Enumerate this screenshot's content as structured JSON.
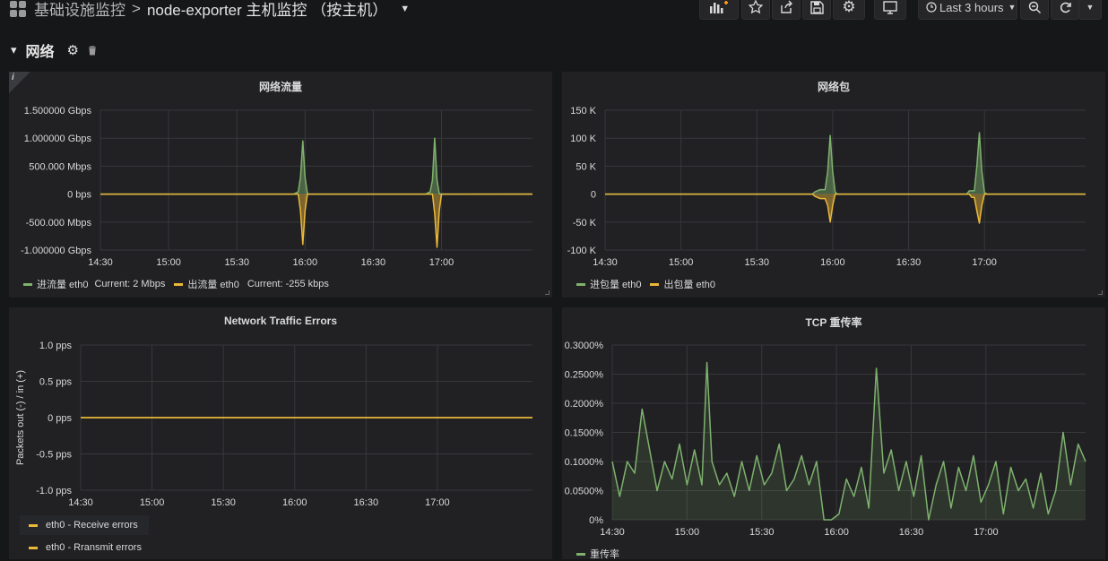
{
  "breadcrumb": {
    "parent": "基础设施监控",
    "separator": ">",
    "current": "node-exporter 主机监控 （按主机）"
  },
  "toolbar": {
    "time_range": "Last 3 hours"
  },
  "row": {
    "title": "网络"
  },
  "colors": {
    "green": "#7eb26d",
    "yellow": "#eab839"
  },
  "chart_data": [
    {
      "id": "panel1",
      "type": "line",
      "title": "网络流量",
      "x_ticks": [
        "14:30",
        "15:00",
        "15:30",
        "16:00",
        "16:30",
        "17:00"
      ],
      "x_range": [
        "14:30",
        "17:40"
      ],
      "ylim": [
        -1000000000,
        1500000000
      ],
      "y_ticks": [
        {
          "value": 1500000000,
          "label": "1.500000 Gbps"
        },
        {
          "value": 1000000000,
          "label": "1.000000 Gbps"
        },
        {
          "value": 500000000,
          "label": "500.000 Mbps"
        },
        {
          "value": 0,
          "label": "0 bps"
        },
        {
          "value": -500000000,
          "label": "-500.000 Mbps"
        },
        {
          "value": -1000000000,
          "label": "-1.000000 Gbps"
        }
      ],
      "series": [
        {
          "name": "进流量 eth0",
          "color": "#7eb26d",
          "current": "Current: 2 Mbps",
          "points": [
            [
              "14:30",
              0
            ],
            [
              "15:55",
              0
            ],
            [
              "15:57",
              40000000
            ],
            [
              "15:58",
              300000000
            ],
            [
              "15:59",
              950000000
            ],
            [
              "16:00",
              300000000
            ],
            [
              "16:01",
              10000000
            ],
            [
              "16:02",
              0
            ],
            [
              "16:53",
              0
            ],
            [
              "16:55",
              40000000
            ],
            [
              "16:56",
              250000000
            ],
            [
              "16:57",
              1000000000
            ],
            [
              "16:58",
              250000000
            ],
            [
              "16:59",
              10000000
            ],
            [
              "17:00",
              0
            ],
            [
              "17:40",
              2000000
            ]
          ]
        },
        {
          "name": "出流量 eth0",
          "color": "#eab839",
          "current": "Current: -255 kbps",
          "points": [
            [
              "14:30",
              0
            ],
            [
              "15:57",
              0
            ],
            [
              "15:58",
              -300000000
            ],
            [
              "15:59",
              -900000000
            ],
            [
              "16:00",
              -300000000
            ],
            [
              "16:01",
              0
            ],
            [
              "16:56",
              0
            ],
            [
              "16:57",
              -350000000
            ],
            [
              "16:58",
              -950000000
            ],
            [
              "16:59",
              -300000000
            ],
            [
              "17:00",
              0
            ],
            [
              "17:40",
              -255000
            ]
          ]
        }
      ]
    },
    {
      "id": "panel2",
      "type": "line",
      "title": "网络包",
      "x_ticks": [
        "14:30",
        "15:00",
        "15:30",
        "16:00",
        "16:30",
        "17:00"
      ],
      "x_range": [
        "14:30",
        "17:40"
      ],
      "ylim": [
        -100000,
        150000
      ],
      "y_ticks": [
        {
          "value": 150000,
          "label": "150 K"
        },
        {
          "value": 100000,
          "label": "100 K"
        },
        {
          "value": 50000,
          "label": "50 K"
        },
        {
          "value": 0,
          "label": "0"
        },
        {
          "value": -50000,
          "label": "-50 K"
        },
        {
          "value": -100000,
          "label": "-100 K"
        }
      ],
      "series": [
        {
          "name": "进包量 eth0",
          "color": "#7eb26d",
          "points": [
            [
              "14:30",
              0
            ],
            [
              "15:52",
              0
            ],
            [
              "15:53",
              4000
            ],
            [
              "15:55",
              8000
            ],
            [
              "15:57",
              8000
            ],
            [
              "15:58",
              40000
            ],
            [
              "15:59",
              105000
            ],
            [
              "16:00",
              40000
            ],
            [
              "16:01",
              3000
            ],
            [
              "16:02",
              0
            ],
            [
              "16:53",
              0
            ],
            [
              "16:54",
              6000
            ],
            [
              "16:56",
              6000
            ],
            [
              "16:57",
              50000
            ],
            [
              "16:58",
              110000
            ],
            [
              "16:59",
              40000
            ],
            [
              "17:00",
              3000
            ],
            [
              "17:01",
              0
            ],
            [
              "17:40",
              0
            ]
          ]
        },
        {
          "name": "出包量 eth0",
          "color": "#eab839",
          "points": [
            [
              "14:30",
              0
            ],
            [
              "15:52",
              0
            ],
            [
              "15:53",
              -4000
            ],
            [
              "15:55",
              -8000
            ],
            [
              "15:57",
              -8000
            ],
            [
              "15:58",
              -20000
            ],
            [
              "15:59",
              -50000
            ],
            [
              "16:00",
              -20000
            ],
            [
              "16:01",
              0
            ],
            [
              "16:54",
              0
            ],
            [
              "16:55",
              -6000
            ],
            [
              "16:56",
              -6000
            ],
            [
              "16:57",
              -30000
            ],
            [
              "16:58",
              -52000
            ],
            [
              "16:59",
              -20000
            ],
            [
              "17:00",
              0
            ],
            [
              "17:40",
              0
            ]
          ]
        }
      ]
    },
    {
      "id": "panel3",
      "type": "line",
      "title": "Network Traffic Errors",
      "ylabel": "Packets out (-) / in (+)",
      "x_ticks": [
        "14:30",
        "15:00",
        "15:30",
        "16:00",
        "16:30",
        "17:00"
      ],
      "x_range": [
        "14:30",
        "17:40"
      ],
      "ylim": [
        -1,
        1
      ],
      "y_ticks": [
        {
          "value": 1,
          "label": "1.0 pps"
        },
        {
          "value": 0.5,
          "label": "0.5 pps"
        },
        {
          "value": 0,
          "label": "0 pps"
        },
        {
          "value": -0.5,
          "label": "-0.5 pps"
        },
        {
          "value": -1,
          "label": "-1.0 pps"
        }
      ],
      "series": [
        {
          "name": "eth0 - Receive errors",
          "color": "#eab839",
          "points": [
            [
              "14:30",
              0
            ],
            [
              "17:40",
              0
            ]
          ]
        },
        {
          "name": "eth0 - Rransmit errors",
          "color": "#eab839",
          "points": [
            [
              "14:30",
              0
            ],
            [
              "17:40",
              0
            ]
          ]
        }
      ]
    },
    {
      "id": "panel4",
      "type": "area",
      "title": "TCP 重传率",
      "x_ticks": [
        "14:30",
        "15:00",
        "15:30",
        "16:00",
        "16:30",
        "17:00"
      ],
      "x_range": [
        "14:30",
        "17:40"
      ],
      "ylim": [
        0,
        0.3
      ],
      "y_ticks": [
        {
          "value": 0.3,
          "label": "0.3000%"
        },
        {
          "value": 0.25,
          "label": "0.2500%"
        },
        {
          "value": 0.2,
          "label": "0.2000%"
        },
        {
          "value": 0.15,
          "label": "0.1500%"
        },
        {
          "value": 0.1,
          "label": "0.1000%"
        },
        {
          "value": 0.05,
          "label": "0.0500%"
        },
        {
          "value": 0,
          "label": "0%"
        }
      ],
      "series": [
        {
          "name": "重传率",
          "color": "#7eb26d",
          "points": [
            [
              "14:30",
              0.1
            ],
            [
              "14:33",
              0.04
            ],
            [
              "14:36",
              0.1
            ],
            [
              "14:39",
              0.08
            ],
            [
              "14:42",
              0.19
            ],
            [
              "14:45",
              0.12
            ],
            [
              "14:48",
              0.05
            ],
            [
              "14:51",
              0.1
            ],
            [
              "14:54",
              0.07
            ],
            [
              "14:57",
              0.13
            ],
            [
              "15:00",
              0.06
            ],
            [
              "15:03",
              0.12
            ],
            [
              "15:06",
              0.06
            ],
            [
              "15:08",
              0.27
            ],
            [
              "15:10",
              0.1
            ],
            [
              "15:13",
              0.06
            ],
            [
              "15:16",
              0.08
            ],
            [
              "15:19",
              0.04
            ],
            [
              "15:22",
              0.1
            ],
            [
              "15:25",
              0.05
            ],
            [
              "15:28",
              0.11
            ],
            [
              "15:31",
              0.06
            ],
            [
              "15:34",
              0.08
            ],
            [
              "15:37",
              0.13
            ],
            [
              "15:40",
              0.05
            ],
            [
              "15:43",
              0.07
            ],
            [
              "15:46",
              0.11
            ],
            [
              "15:49",
              0.06
            ],
            [
              "15:52",
              0.1
            ],
            [
              "15:55",
              0.0
            ],
            [
              "15:58",
              0.0
            ],
            [
              "16:01",
              0.01
            ],
            [
              "16:04",
              0.07
            ],
            [
              "16:07",
              0.04
            ],
            [
              "16:10",
              0.09
            ],
            [
              "16:13",
              0.02
            ],
            [
              "16:16",
              0.26
            ],
            [
              "16:19",
              0.08
            ],
            [
              "16:22",
              0.12
            ],
            [
              "16:25",
              0.05
            ],
            [
              "16:28",
              0.1
            ],
            [
              "16:31",
              0.04
            ],
            [
              "16:34",
              0.11
            ],
            [
              "16:37",
              0.0
            ],
            [
              "16:40",
              0.06
            ],
            [
              "16:43",
              0.1
            ],
            [
              "16:46",
              0.02
            ],
            [
              "16:49",
              0.09
            ],
            [
              "16:52",
              0.05
            ],
            [
              "16:55",
              0.11
            ],
            [
              "16:58",
              0.03
            ],
            [
              "17:01",
              0.06
            ],
            [
              "17:04",
              0.1
            ],
            [
              "17:07",
              0.01
            ],
            [
              "17:10",
              0.09
            ],
            [
              "17:13",
              0.05
            ],
            [
              "17:16",
              0.07
            ],
            [
              "17:19",
              0.02
            ],
            [
              "17:22",
              0.08
            ],
            [
              "17:25",
              0.01
            ],
            [
              "17:28",
              0.05
            ],
            [
              "17:31",
              0.15
            ],
            [
              "17:34",
              0.06
            ],
            [
              "17:37",
              0.13
            ],
            [
              "17:40",
              0.1
            ]
          ]
        }
      ]
    }
  ]
}
